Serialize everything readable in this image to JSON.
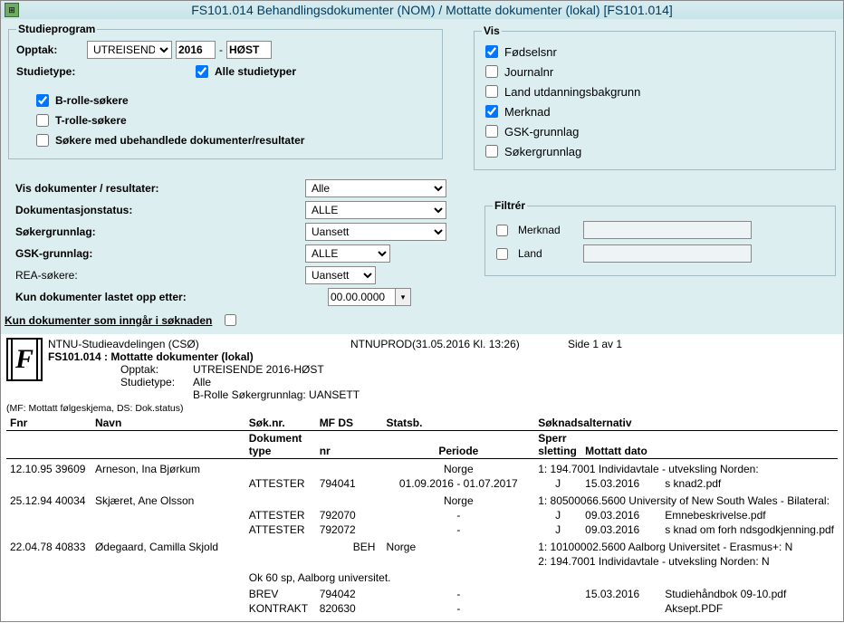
{
  "title": "FS101.014 Behandlingsdokumenter (NOM) / Mottatte dokumenter (lokal)   [FS101.014]",
  "studieprogram": {
    "legend": "Studieprogram",
    "opptak_label": "Opptak:",
    "opptak_value": "UTREISENDE",
    "year": "2016",
    "semester": "HØST",
    "studietype_label": "Studietype:",
    "alle_studietyper": "Alle studietyper",
    "b_rolle": "B-rolle-søkere",
    "t_rolle": "T-rolle-søkere",
    "ubehandlede": "Søkere med ubehandlede dokumenter/resultater"
  },
  "vis": {
    "legend": "Vis",
    "fodselsnr": "Fødselsnr",
    "journalnr": "Journalnr",
    "land": "Land utdanningsbakgrunn",
    "merknad": "Merknad",
    "gsk": "GSK-grunnlag",
    "sokergrunnlag": "Søkergrunnlag"
  },
  "filters": {
    "vis_dok_label": "Vis dokumenter / resultater:",
    "vis_dok_value": "Alle",
    "dok_status_label": "Dokumentasjonstatus:",
    "dok_status_value": "ALLE",
    "sokergrunnlag_label": "Søkergrunnlag:",
    "sokergrunnlag_value": "Uansett",
    "gsk_label": "GSK-grunnlag:",
    "gsk_value": "ALLE",
    "rea_label": "REA-søkere:",
    "rea_value": "Uansett",
    "kun_dato_label": "Kun dokumenter lastet opp etter:",
    "kun_dato_value": "00.00.0000",
    "kun_inngar": "Kun dokumenter som inngår i søknaden"
  },
  "filtrer": {
    "legend": "Filtrér",
    "merknad": "Merknad",
    "land": "Land"
  },
  "report": {
    "org": "NTNU-Studieavdelingen  (CSØ)",
    "server": "NTNUPROD",
    "timestamp": "(31.05.2016 Kl. 13:26)",
    "page": "Side 1 av 1",
    "title2": "FS101.014 : Mottatte dokumenter (lokal)",
    "opptak_lbl": "Opptak:",
    "opptak_val": "UTREISENDE 2016-HØST",
    "studietype_lbl": "Studietype:",
    "studietype_val": "Alle",
    "brolle": "B-Rolle Søkergrunnlag: UANSETT",
    "mf_note": "(MF: Mottatt følgeskjema, DS: Dok.status)"
  },
  "headers": {
    "fnr": "Fnr",
    "navn": "Navn",
    "soknr": "Søk.nr.",
    "mf": "MF",
    "ds": "DS",
    "statsb": "Statsb.",
    "soknadsalt": "Søknadsalternativ",
    "doktype": "Dokument type",
    "nr": "nr",
    "periode": "Periode",
    "sperr": "Sperr sletting",
    "mottatt": "Mottatt dato"
  },
  "rows": {
    "p1_fnr": "12.10.95 39609",
    "p1_navn": "Arneson, Ina Bjørkum",
    "p1_statsb": "Norge",
    "p1_alt1": "1: 194.7001 Individavtale - utveksling Norden:",
    "p1_d1_type": "ATTESTER",
    "p1_d1_nr": "794041",
    "p1_d1_periode": "01.09.2016 - 01.07.2017",
    "p1_d1_sperr": "J",
    "p1_d1_dato": "15.03.2016",
    "p1_d1_fil": "s knad2.pdf",
    "p2_fnr": "25.12.94 40034",
    "p2_navn": "Skjæret, Ane Olsson",
    "p2_statsb": "Norge",
    "p2_alt1": "1: 80500066.5600 University of New South Wales - Bilateral:",
    "p2_d1_type": "ATTESTER",
    "p2_d1_nr": "792070",
    "p2_d1_periode": "-",
    "p2_d1_sperr": "J",
    "p2_d1_dato": "09.03.2016",
    "p2_d1_fil": "Emnebeskrivelse.pdf",
    "p2_d2_type": "ATTESTER",
    "p2_d2_nr": "792072",
    "p2_d2_periode": "-",
    "p2_d2_sperr": "J",
    "p2_d2_dato": "09.03.2016",
    "p2_d2_fil": "s knad  om  forh  ndsgodkjenning.pdf",
    "p3_fnr": "22.04.78 40833",
    "p3_navn": "Ødegaard, Camilla Skjold",
    "p3_ds": "BEH",
    "p3_statsb": "Norge",
    "p3_alt1": "1: 10100002.5600 Aalborg Universitet - Erasmus+: N",
    "p3_alt2": "2: 194.7001 Individavtale - utveksling Norden: N",
    "p3_note": "Ok 60 sp, Aalborg universitet.",
    "p3_d1_type": "BREV",
    "p3_d1_nr": "794042",
    "p3_d1_periode": "-",
    "p3_d1_dato": "15.03.2016",
    "p3_d1_fil": "Studiehåndbok 09-10.pdf",
    "p3_d2_type": "KONTRAKT",
    "p3_d2_nr": "820630",
    "p3_d2_periode": "-",
    "p3_d2_fil": "Aksept.PDF"
  }
}
